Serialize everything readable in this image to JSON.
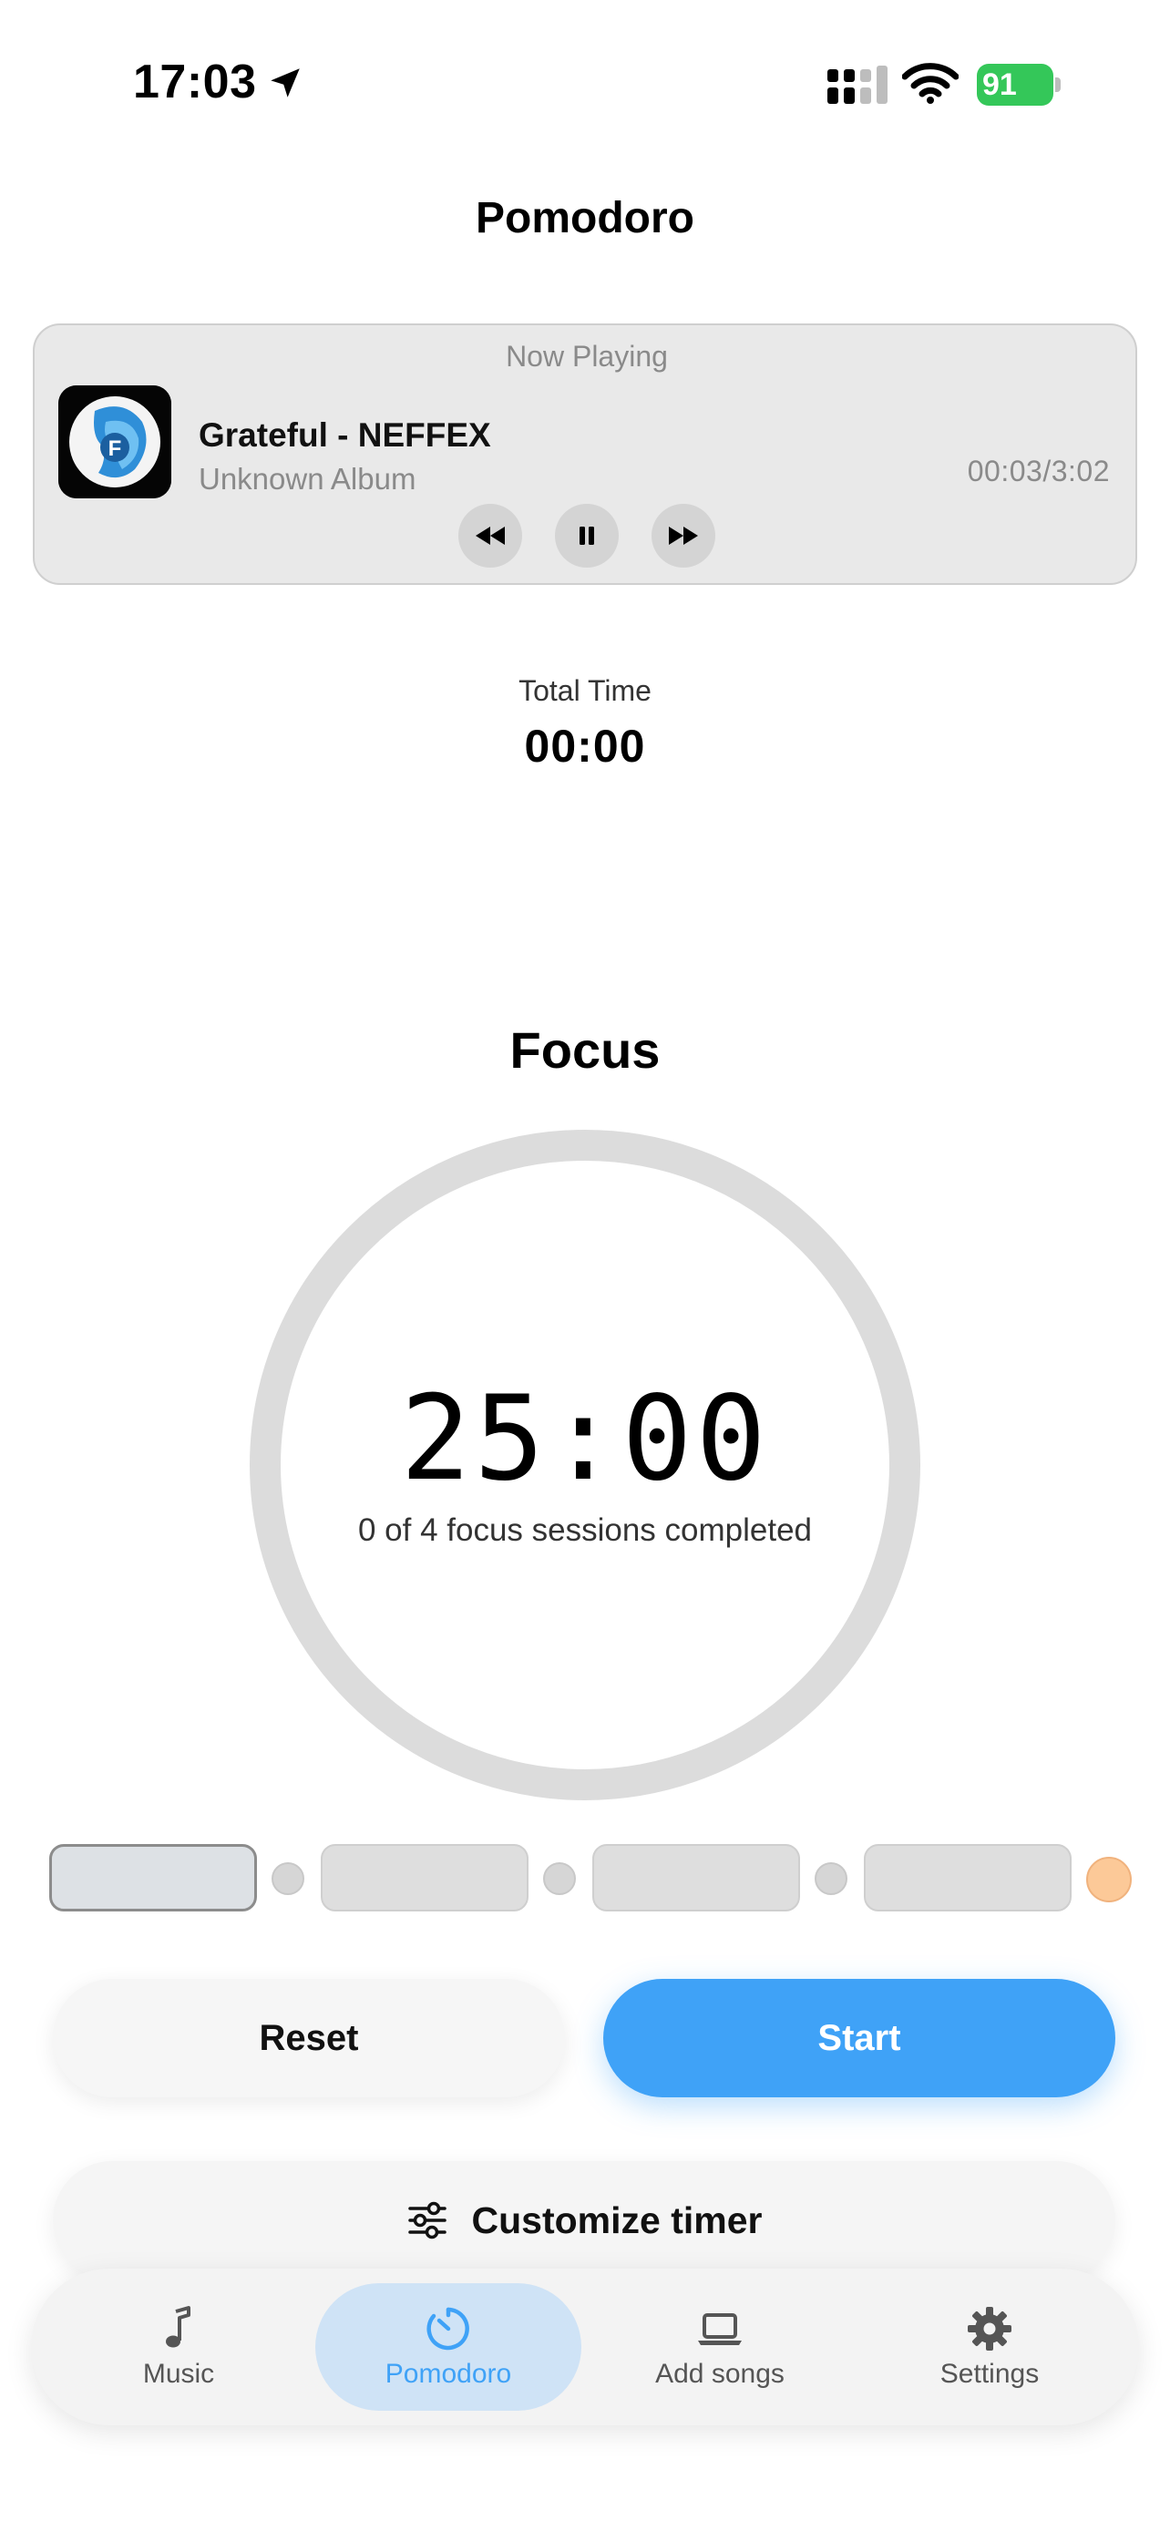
{
  "status_bar": {
    "time": "17:03",
    "battery": "91"
  },
  "header": {
    "title": "Pomodoro"
  },
  "now_playing": {
    "label": "Now Playing",
    "track_title": "Grateful - NEFFEX",
    "album": "Unknown Album",
    "time": "00:03/3:02"
  },
  "total": {
    "label": "Total Time",
    "value": "00:00"
  },
  "focus": {
    "mode": "Focus",
    "timer": "25:00",
    "sessions_text": "0 of 4 focus sessions completed",
    "completed": 0,
    "total_sessions": 4
  },
  "buttons": {
    "reset": "Reset",
    "start": "Start",
    "customize": "Customize timer"
  },
  "tabs": [
    {
      "label": "Music",
      "icon": "music-note-icon"
    },
    {
      "label": "Pomodoro",
      "icon": "timer-icon",
      "active": true
    },
    {
      "label": "Add songs",
      "icon": "laptop-icon"
    },
    {
      "label": "Settings",
      "icon": "gear-icon"
    }
  ],
  "colors": {
    "accent": "#3fa2f7",
    "battery": "#34c759",
    "long_break": "#fcc998",
    "active_tab_bg": "#cfe3f6"
  }
}
